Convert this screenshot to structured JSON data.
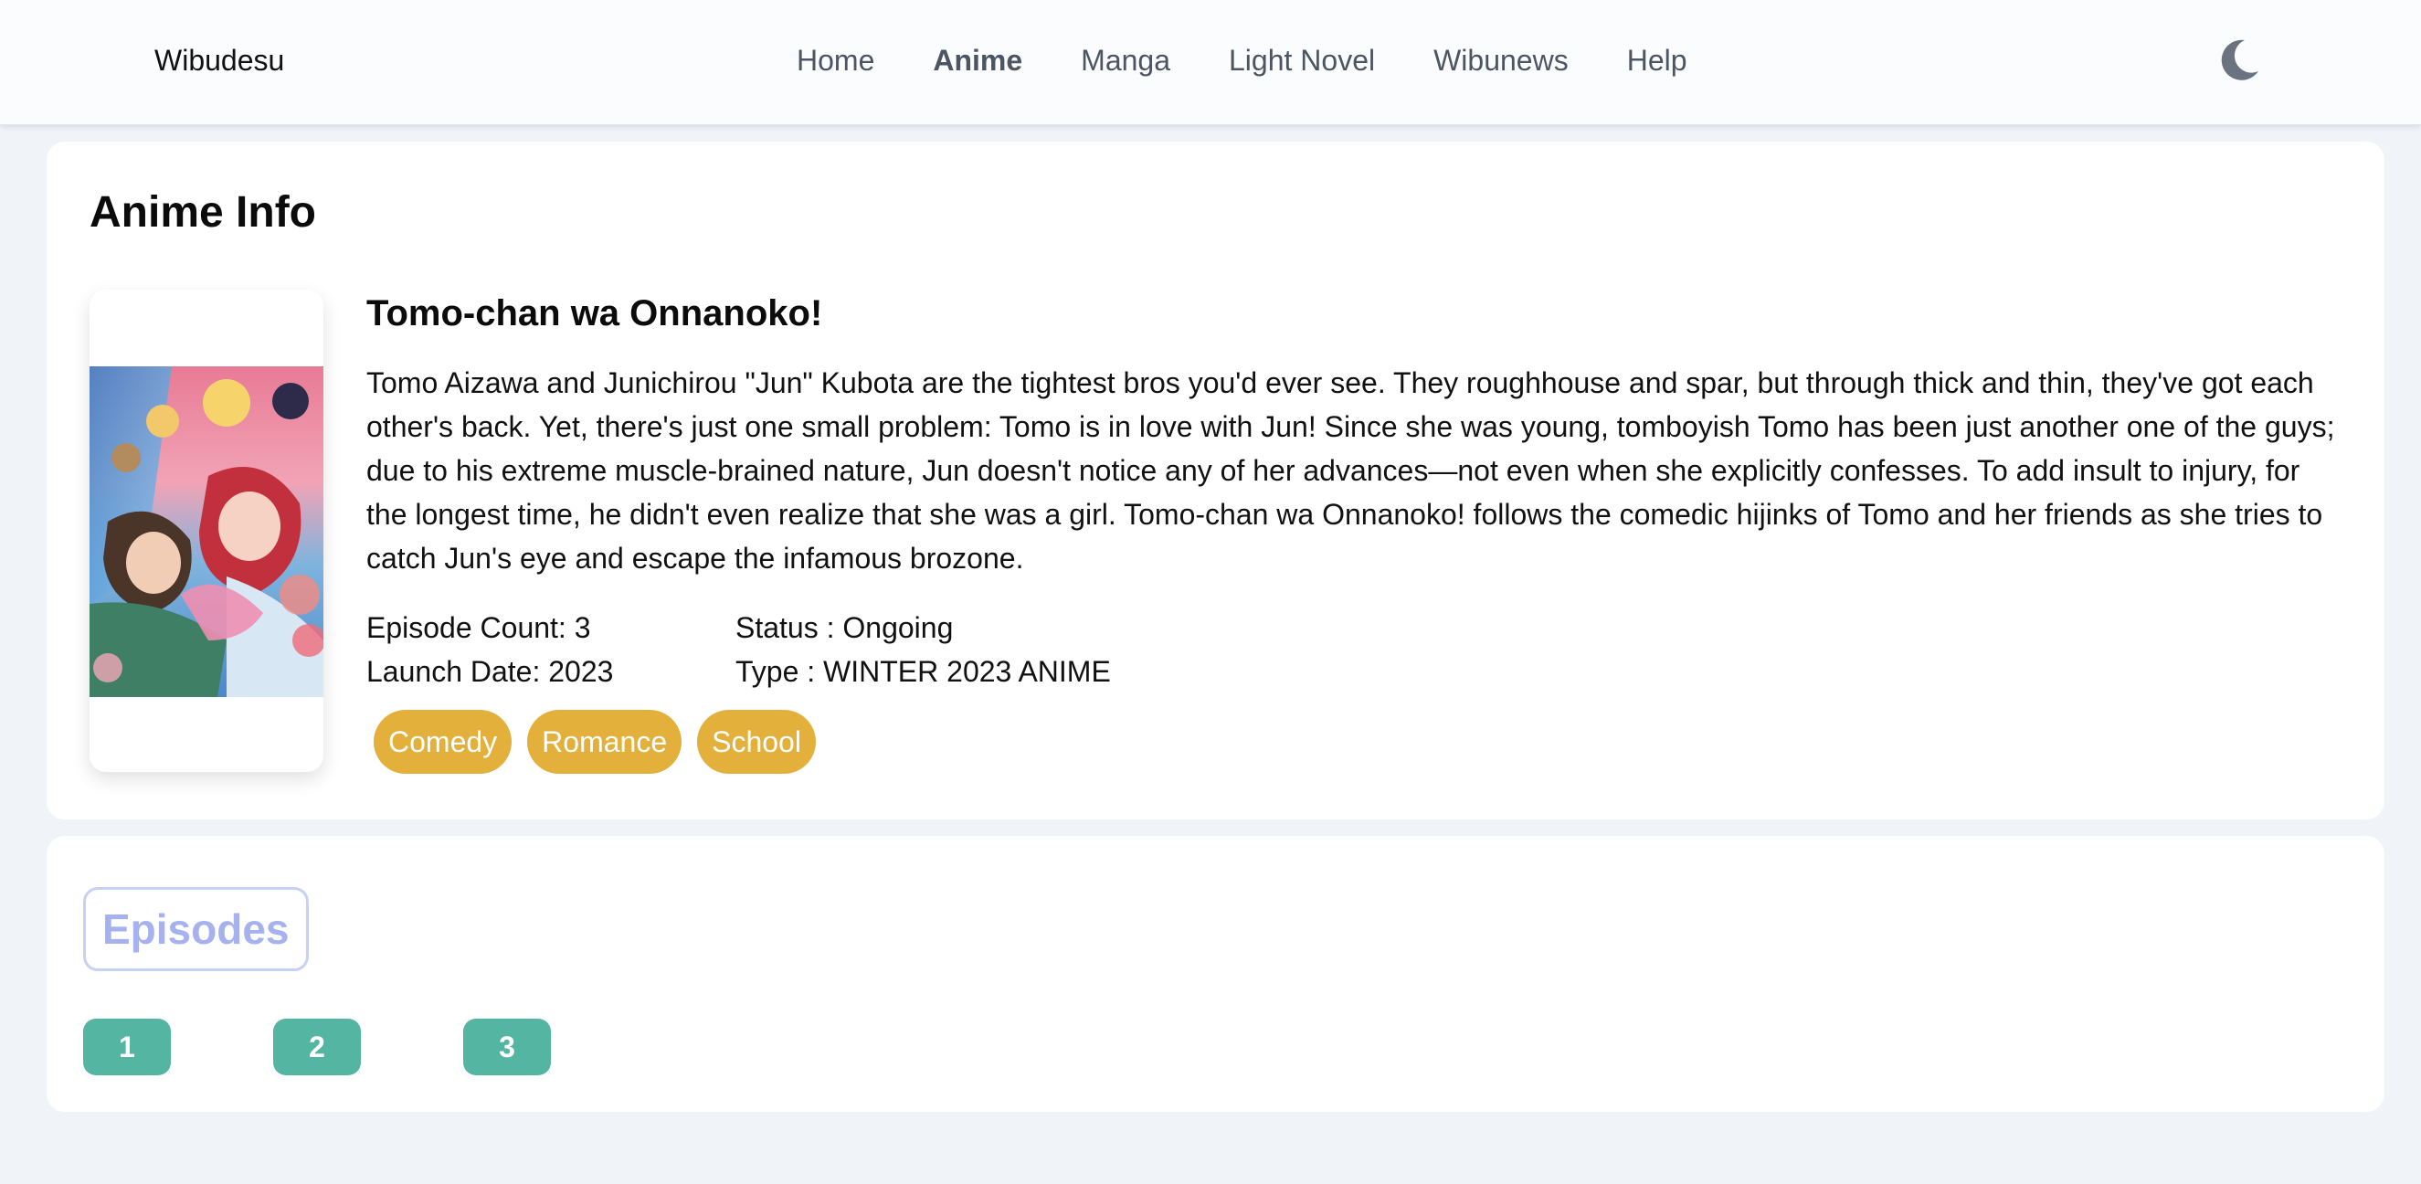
{
  "header": {
    "brand": "Wibudesu",
    "nav": [
      {
        "label": "Home",
        "active": false
      },
      {
        "label": "Anime",
        "active": true
      },
      {
        "label": "Manga",
        "active": false
      },
      {
        "label": "Light Novel",
        "active": false
      },
      {
        "label": "Wibunews",
        "active": false
      },
      {
        "label": "Help",
        "active": false
      }
    ],
    "theme_toggle_icon": "moon-icon"
  },
  "info": {
    "section_title": "Anime Info",
    "poster_icon": "anime-poster",
    "title": "Tomo-chan wa Onnanoko!",
    "synopsis": "Tomo Aizawa and Junichirou \"Jun\" Kubota are the tightest bros you'd ever see. They roughhouse and spar, but through thick and thin, they've got each other's back. Yet, there's just one small problem: Tomo is in love with Jun! Since she was young, tomboyish Tomo has been just another one of the guys; due to his extreme muscle-brained nature, Jun doesn't notice any of her advances—not even when she explicitly confesses. To add insult to injury, for the longest time, he didn't even realize that she was a girl. Tomo-chan wa Onnanoko! follows the comedic hijinks of Tomo and her friends as she tries to catch Jun's eye and escape the infamous brozone.",
    "episode_count": "Episode Count: 3",
    "status": "Status : Ongoing",
    "launch_date": "Launch Date: 2023",
    "type": "Type : WINTER 2023 ANIME",
    "genres": [
      "Comedy",
      "Romance",
      "School"
    ]
  },
  "episodes": {
    "heading": "Episodes",
    "items": [
      "1",
      "2",
      "3"
    ]
  },
  "colors": {
    "page_background": "#f0f4f9",
    "genre_tag": "#e3b03c",
    "episode_button": "#55b5a3",
    "episodes_heading": "#a5b2ef"
  }
}
